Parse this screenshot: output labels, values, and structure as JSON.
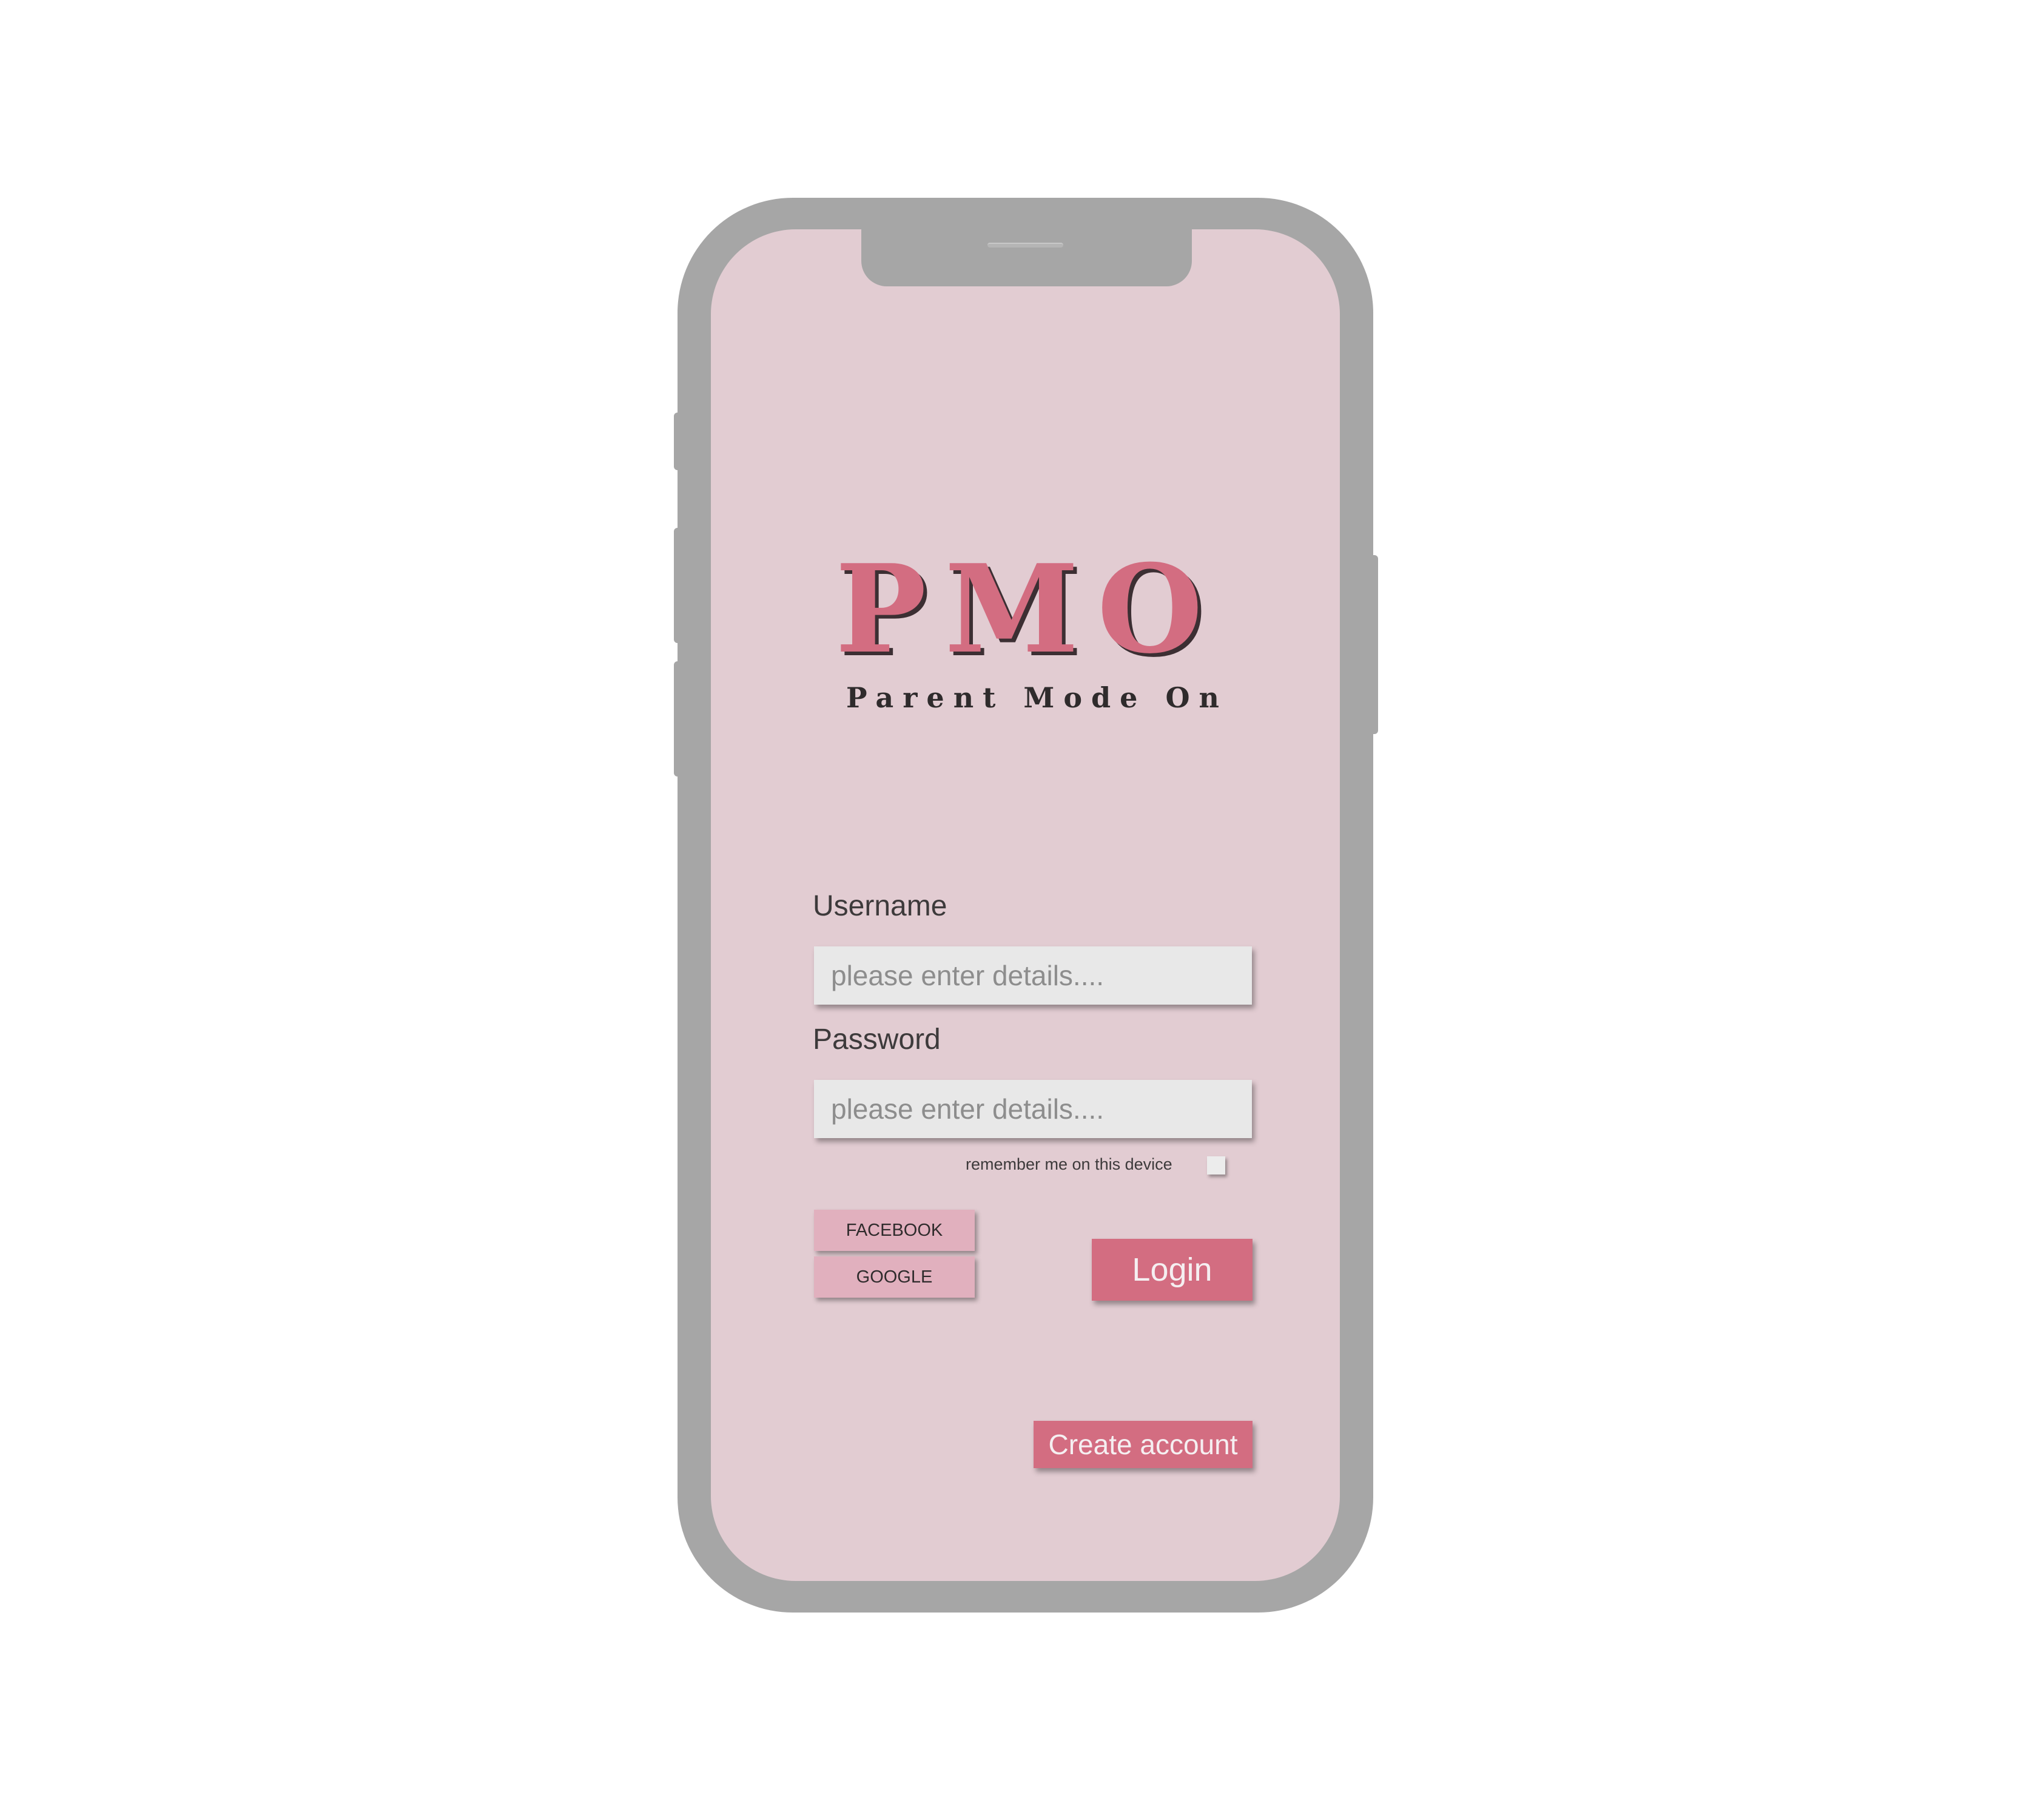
{
  "brand": {
    "logo_text": "PMO",
    "tagline": "Parent Mode On",
    "logo_color": "#d36d81"
  },
  "form": {
    "username_label": "Username",
    "username_placeholder": "please enter details....",
    "password_label": "Password",
    "password_placeholder": "please enter details....",
    "remember_label": "remember me on this device",
    "remember_checked": false
  },
  "buttons": {
    "facebook": "FACEBOOK",
    "google": "GOOGLE",
    "login": "Login",
    "create_account": "Create account"
  },
  "colors": {
    "screen_background": "#e2ccd2",
    "accent": "#d36d81",
    "social_button": "#e1b0be",
    "device_frame": "#a6a6a6"
  }
}
